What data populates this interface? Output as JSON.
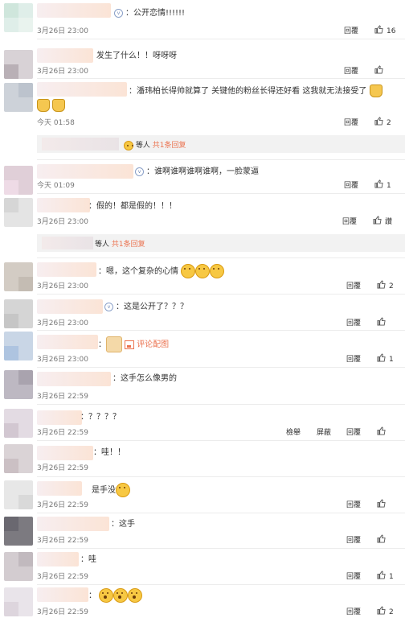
{
  "ui": {
    "reply_label": "回覆",
    "report_label": "檢舉",
    "block_label": "屏蔽"
  },
  "comments": [
    {
      "text": "：公开恋情!!!!!!",
      "time": "3月26日 23:00",
      "likes": "16"
    },
    {
      "text": "发生了什么！！呀呀呀",
      "time": "3月26日 23:00",
      "likes": ""
    },
    {
      "text": "：潘玮柏长得帅就算了  关键他的粉丝长得还好看  这我就无法接受了",
      "time": "今天 01:58",
      "likes": "2",
      "sub_reply": {
        "text": "等人",
        "link": "共1条回复"
      }
    },
    {
      "text": "：谁啊谁啊谁啊谁啊，一脸蒙逼",
      "time": "今天 01:09",
      "likes": "1"
    },
    {
      "text": "：假的！都是假的！！！",
      "time": "3月26日 23:00",
      "likes": "讚",
      "sub_reply": {
        "text": "等人",
        "link": "共1条回复"
      }
    },
    {
      "text": "：嗯，这个复杂的心情",
      "time": "3月26日 23:00",
      "likes": "2"
    },
    {
      "text": "：这是公开了？？？",
      "time": "3月26日 23:00",
      "likes": ""
    },
    {
      "text": "：",
      "image_label": "评论配图",
      "time": "3月26日 23:00",
      "likes": "1"
    },
    {
      "text": "：这手怎么像男的",
      "time": "3月26日 22:59",
      "likes": ""
    },
    {
      "text": "：？？？？",
      "time": "3月26日 22:59",
      "likes": ""
    },
    {
      "text": "：哇！！",
      "time": "3月26日 22:59",
      "likes": ""
    },
    {
      "text": "是手没",
      "time": "3月26日 22:59",
      "likes": ""
    },
    {
      "text": "：这手",
      "time": "3月26日 22:59",
      "likes": ""
    },
    {
      "text": "：哇",
      "time": "3月26日 22:59",
      "likes": "1"
    },
    {
      "text": "：",
      "time": "3月26日 22:59",
      "likes": "2"
    }
  ],
  "colors": {
    "link": "#eb7350",
    "time": "#777777",
    "separator": "#ececec",
    "subbox": "#f2f2f2"
  },
  "icons": {
    "thumb": "thumbs-up-icon",
    "verified": "verified-badge-icon",
    "emoji": "smiley-emoji"
  }
}
